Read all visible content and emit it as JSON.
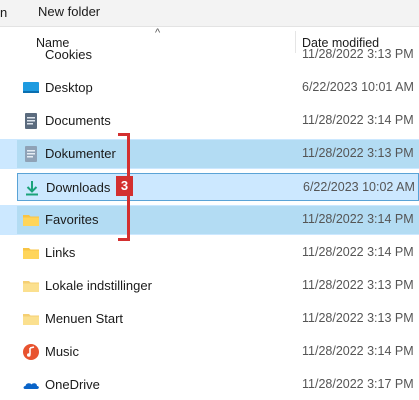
{
  "toolbar": {
    "edge_label": "n",
    "new_folder_label": "New folder"
  },
  "header": {
    "name_label": "Name",
    "date_label": "Date modified",
    "sort_caret": "^"
  },
  "files": [
    {
      "name": "Cookies",
      "date": "11/28/2022 3:13 PM",
      "icon": "folder-icon"
    },
    {
      "name": "Desktop",
      "date": "6/22/2023 10:01 AM",
      "icon": "desktop-icon"
    },
    {
      "name": "Documents",
      "date": "11/28/2022 3:14 PM",
      "icon": "document-icon"
    },
    {
      "name": "Dokumenter",
      "date": "11/28/2022 3:13 PM",
      "icon": "document-shortcut-icon"
    },
    {
      "name": "Downloads",
      "date": "6/22/2023 10:02 AM",
      "icon": "download-icon"
    },
    {
      "name": "Favorites",
      "date": "11/28/2022 3:14 PM",
      "icon": "folder-icon"
    },
    {
      "name": "Links",
      "date": "11/28/2022 3:14 PM",
      "icon": "folder-icon"
    },
    {
      "name": "Lokale indstillinger",
      "date": "11/28/2022 3:13 PM",
      "icon": "folder-shortcut-icon"
    },
    {
      "name": "Menuen Start",
      "date": "11/28/2022 3:13 PM",
      "icon": "folder-shortcut-icon"
    },
    {
      "name": "Music",
      "date": "11/28/2022 3:14 PM",
      "icon": "music-icon"
    },
    {
      "name": "OneDrive",
      "date": "11/28/2022 3:17 PM",
      "icon": "onedrive-icon"
    }
  ],
  "annotation": {
    "badge_label": "3",
    "color": "#d32f2f"
  },
  "colors": {
    "selection": "#cce8ff",
    "folder": "#f8c444",
    "accent": "#0067c0"
  }
}
